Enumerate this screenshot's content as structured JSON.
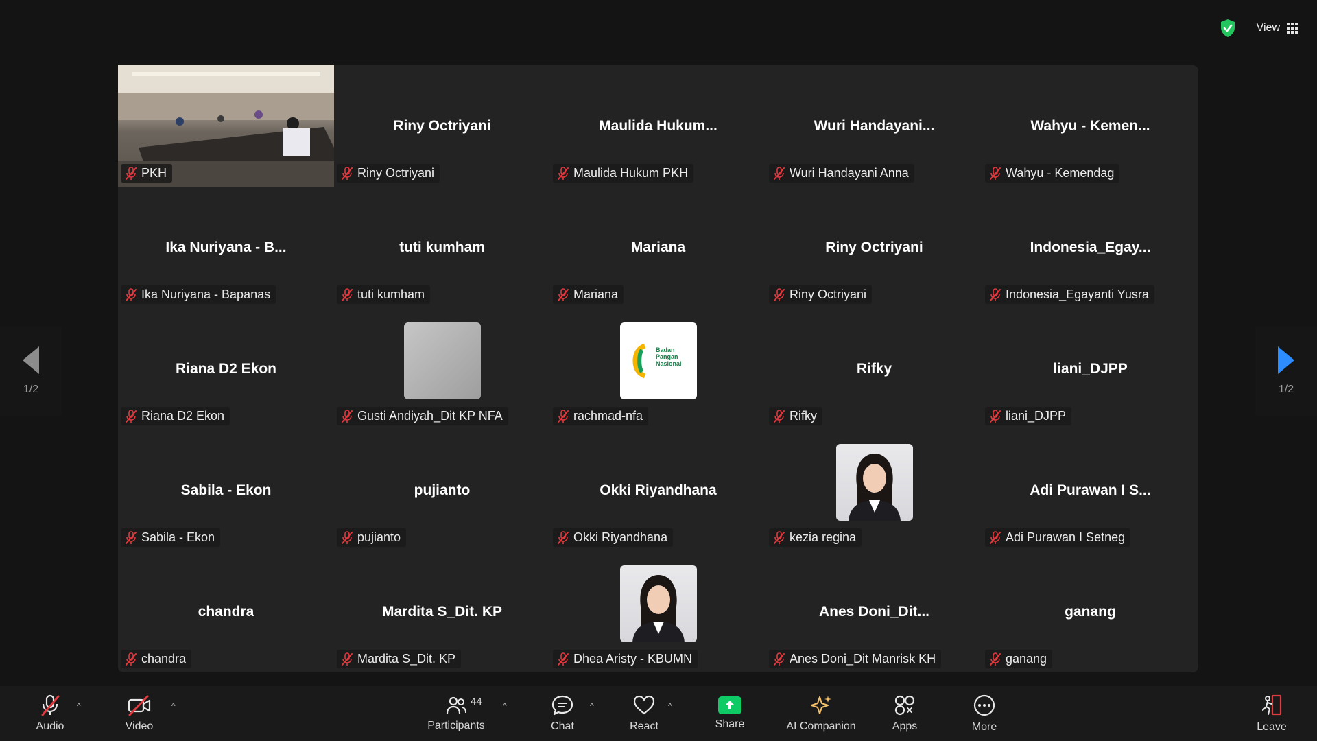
{
  "topbar": {
    "view_label": "View"
  },
  "pager": {
    "left_label": "1/2",
    "right_label": "1/2"
  },
  "tiles": [
    {
      "display": "",
      "nameplate": "PKH",
      "kind": "video"
    },
    {
      "display": "Riny Octriyani",
      "nameplate": "Riny Octriyani",
      "kind": "name"
    },
    {
      "display": "Maulida  Hukum...",
      "nameplate": "Maulida Hukum PKH",
      "kind": "name"
    },
    {
      "display": "Wuri  Handayani...",
      "nameplate": "Wuri Handayani Anna",
      "kind": "name"
    },
    {
      "display": "Wahyu -  Kemen...",
      "nameplate": "Wahyu -  Kemendag",
      "kind": "name"
    },
    {
      "display": "Ika Nuriyana - B...",
      "nameplate": "Ika Nuriyana - Bapanas",
      "kind": "name"
    },
    {
      "display": "tuti kumham",
      "nameplate": "tuti kumham",
      "kind": "name"
    },
    {
      "display": "Mariana",
      "nameplate": "Mariana",
      "kind": "name"
    },
    {
      "display": "Riny Octriyani",
      "nameplate": "Riny Octriyani",
      "kind": "name"
    },
    {
      "display": "Indonesia_Egay...",
      "nameplate": "Indonesia_Egayanti Yusra",
      "kind": "name"
    },
    {
      "display": "Riana D2 Ekon",
      "nameplate": "Riana D2 Ekon",
      "kind": "name"
    },
    {
      "display": "",
      "nameplate": "Gusti Andiyah_Dit KP NFA",
      "kind": "avatar-grey"
    },
    {
      "display": "",
      "nameplate": "rachmad-nfa",
      "kind": "avatar-logo",
      "logo_lines": [
        "Badan",
        "Pangan",
        "Nasional"
      ]
    },
    {
      "display": "Rifky",
      "nameplate": "Rifky",
      "kind": "name"
    },
    {
      "display": "liani_DJPP",
      "nameplate": "liani_DJPP",
      "kind": "name"
    },
    {
      "display": "Sabila - Ekon",
      "nameplate": "Sabila - Ekon",
      "kind": "name"
    },
    {
      "display": "pujianto",
      "nameplate": "pujianto",
      "kind": "name"
    },
    {
      "display": "Okki Riyandhana",
      "nameplate": "Okki Riyandhana",
      "kind": "name"
    },
    {
      "display": "",
      "nameplate": "kezia regina",
      "kind": "avatar-photo"
    },
    {
      "display": "Adi Purawan I S...",
      "nameplate": "Adi Purawan I Setneg",
      "kind": "name"
    },
    {
      "display": "chandra",
      "nameplate": "chandra",
      "kind": "name"
    },
    {
      "display": "Mardita S_Dit. KP",
      "nameplate": "Mardita S_Dit. KP",
      "kind": "name"
    },
    {
      "display": "",
      "nameplate": "Dhea Aristy - KBUMN",
      "kind": "avatar-photo"
    },
    {
      "display": "Anes  Doni_Dit...",
      "nameplate": "Anes Doni_Dit Manrisk KH",
      "kind": "name"
    },
    {
      "display": "ganang",
      "nameplate": "ganang",
      "kind": "name"
    }
  ],
  "toolbar": {
    "audio": "Audio",
    "video": "Video",
    "participants": "Participants",
    "participants_count": "44",
    "chat": "Chat",
    "react": "React",
    "share": "Share",
    "ai_companion": "AI Companion",
    "apps": "Apps",
    "more": "More",
    "leave": "Leave"
  },
  "colors": {
    "accent_blue": "#2d8cff",
    "share_green": "#0ecb65",
    "muted_red": "#e0393e",
    "shield_green": "#23c55e"
  }
}
